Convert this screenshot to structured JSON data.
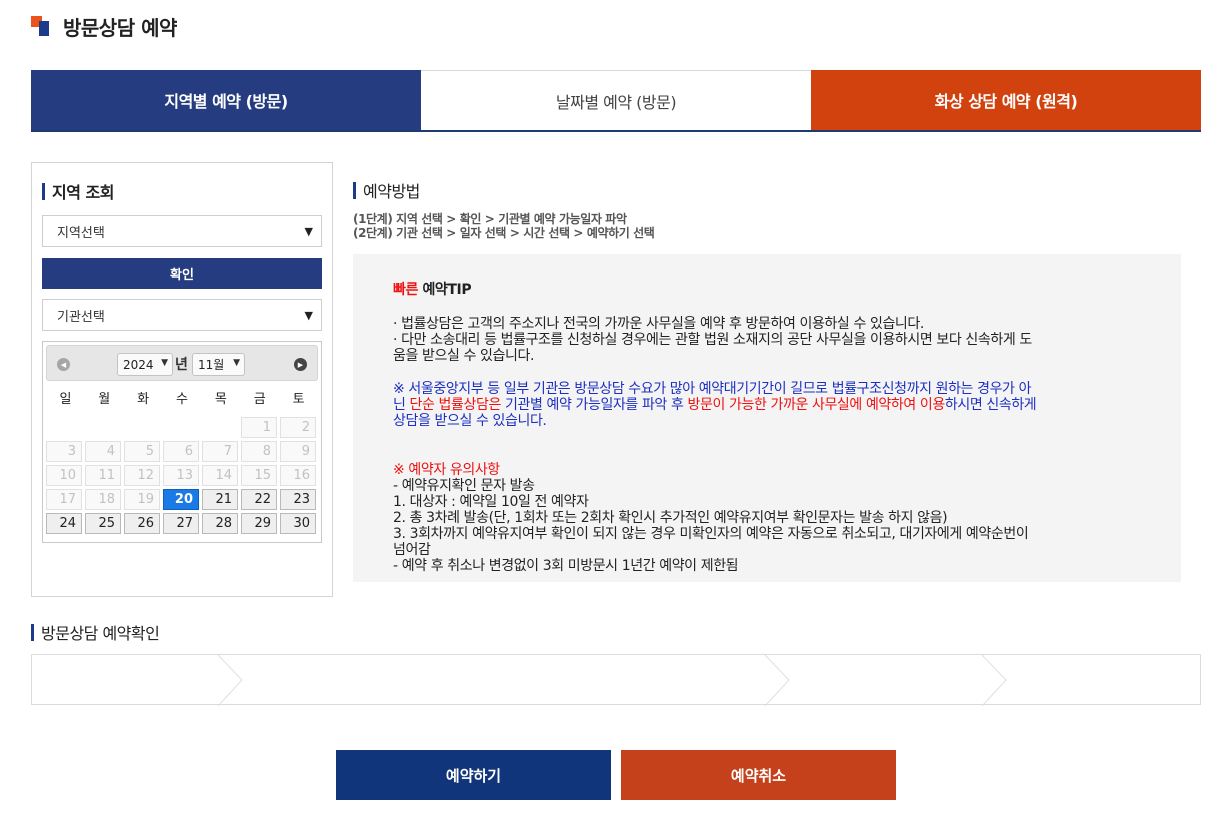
{
  "page": {
    "title": "방문상담 예약"
  },
  "tabs": [
    {
      "label": "지역별 예약 (방문)"
    },
    {
      "label": "날짜별 예약 (방문)"
    },
    {
      "label": "화상 상담 예약 (원격)"
    }
  ],
  "region": {
    "title": "지역 조회",
    "region_select": "지역선택",
    "confirm_label": "확인",
    "agency_select": "기관선택"
  },
  "calendar": {
    "year": "2024",
    "year_unit": "년",
    "month": "11월",
    "weekdays": [
      "일",
      "월",
      "화",
      "수",
      "목",
      "금",
      "토"
    ],
    "today": 20,
    "leading_blanks": 5,
    "days_in_month": 30,
    "first_enabled_day": 20
  },
  "method": {
    "title": "예약방법",
    "step1": "(1단계) 지역 선택 > 확인 > 기관별 예약 가능일자 파악",
    "step2": "(2단계) 기관 선택 > 일자 선택 > 시간 선택 > 예약하기 선택",
    "tip_title_red": "빠른",
    "tip_title_rest": " 예약TIP",
    "tip_line1": "· 법률상담은 고객의 주소지나 전국의 가까운 사무실을 예약 후 방문하여 이용하실 수 있습니다.",
    "tip_line2a": "· 다만 소송대리 등 법률구조를 신청하실 경우에는 관할 법원 소재지의 공단 사무실을 이용하시면 보다 신속하게 도",
    "tip_line2b": "움을 받으실 수 있습니다.",
    "notice_a": "※ 서울중앙지부 등 일부 기관은 방문상담 수요가 많아 예약대기기간이 길므로 법률구조신청까지 원하는 경우가 아",
    "notice_b1": "닌 ",
    "notice_b2": "단순 법률상담은",
    "notice_b3": " 기관별 예약 가능일자를 파악 후 ",
    "notice_b4": "방문이 가능한 가까운 사무실에 예약하여 이용",
    "notice_b5": "하시면 신속하게",
    "notice_c": "상담을 받으실 수 있습니다.",
    "caution_title": "※ 예약자 유의사항",
    "caution_lines": [
      "- 예약유지확인 문자 발송",
      "1. 대상자 : 예약일 10일 전 예약자",
      "2. 총 3차례 발송(단, 1회차 또는 2회차 확인시 추가적인 예약유지여부 확인문자는 발송 하지 않음)",
      "3. 3회차까지 예약유지여부 확인이 되지 않는 경우 미확인자의 예약은 자동으로 취소되고, 대기자에게 예약순번이",
      "넘어감",
      "- 예약 후 취소나 변경없이 3회 미방문시 1년간 예약이 제한됨"
    ]
  },
  "confirm_section": {
    "title": "방문상담 예약확인"
  },
  "buttons": {
    "reserve": "예약하기",
    "cancel": "예약취소"
  }
}
